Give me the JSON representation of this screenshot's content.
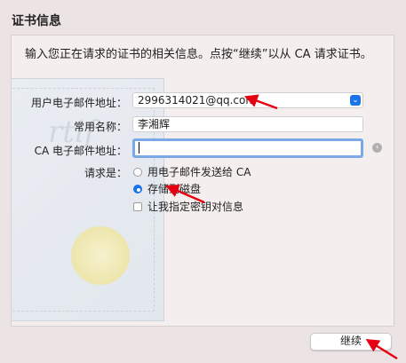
{
  "window": {
    "title": "证书信息"
  },
  "intro": "输入您正在请求的证书的相关信息。点按“继续”以从 CA 请求证书。",
  "form": {
    "email_label": "用户电子邮件地址：",
    "email_value": "2996314021@qq.com",
    "name_label": "常用名称：",
    "name_value": "李湘辉",
    "ca_email_label": "CA 电子邮件地址：",
    "ca_email_value": "",
    "request_label": "请求是：",
    "option_email": "用电子邮件发送给 CA",
    "option_save": "存储到磁盘",
    "option_specify": "让我指定密钥对信息",
    "selected_option": "存储到磁盘"
  },
  "buttons": {
    "continue": "继续"
  },
  "colors": {
    "accent": "#1a73e8",
    "annotation": "#e60012"
  },
  "icons": {
    "dropdown": "chevron-updown-icon",
    "clear": "arrow-left-icon"
  }
}
